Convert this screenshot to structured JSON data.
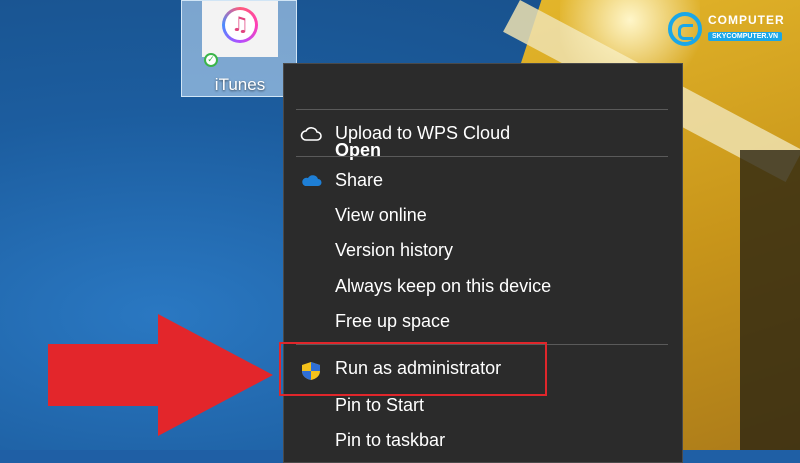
{
  "desktop": {
    "icon": {
      "label": "iTunes",
      "icon": "itunes-icon",
      "status_icon": "sync-check-icon"
    },
    "logo": {
      "text": "COMPUTER",
      "subtext": "SKYCOMPUTER.VN"
    }
  },
  "context_menu": {
    "items": [
      {
        "label": "Open",
        "bold": true
      },
      {
        "label": "Upload to WPS Cloud",
        "icon": "cloud-outline-icon"
      },
      {
        "label": "Share",
        "icon": "onedrive-cloud-icon"
      },
      {
        "label": "View online"
      },
      {
        "label": "Version history"
      },
      {
        "label": "Always keep on this device"
      },
      {
        "label": "Free up space"
      },
      {
        "label": "Run as administrator",
        "icon": "uac-shield-icon",
        "highlighted": true
      },
      {
        "label": "Pin to Start"
      },
      {
        "label": "Pin to taskbar"
      }
    ]
  },
  "colors": {
    "menu_background": "#2b2b2b",
    "highlight_box": "#e0262b",
    "arrow": "#e3262b",
    "onedrive_blue": "#1e7fd6"
  }
}
